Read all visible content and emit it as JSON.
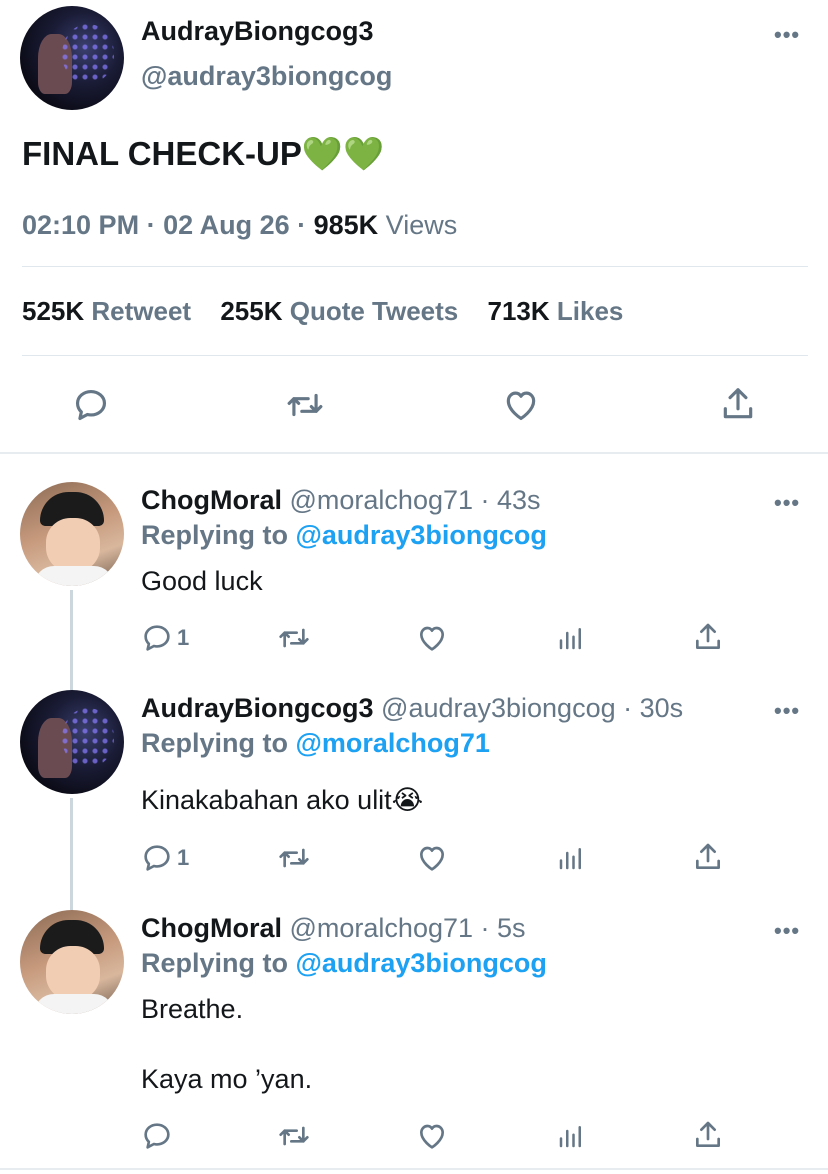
{
  "main_tweet": {
    "author_name": "AudrayBiongcog3",
    "author_handle": "@audray3biongcog",
    "more_icon": "more-icon",
    "text": "FINAL CHECK-UP💚💚",
    "time": "02:10 PM",
    "sep1": " · ",
    "date": "02 Aug 26",
    "sep2": " · ",
    "views_count": "985K",
    "views_label": " Views",
    "retweet_count": "525K",
    "retweet_label": "Retweet",
    "quote_count": "255K",
    "quote_label": "Quote Tweets",
    "likes_count": "713K",
    "likes_label": "Likes",
    "actions": [
      "reply-icon",
      "retweet-icon",
      "like-icon",
      "share-icon"
    ]
  },
  "replies": [
    {
      "name": "ChogMoral",
      "handle": " @moralchog71 · 43s",
      "replying_prefix": "Replying to ",
      "replying_to": "@audray3biongcog",
      "text_lines": [
        "Good luck"
      ],
      "reply_count": "1"
    },
    {
      "name": "AudrayBiongcog3",
      "handle": " @audray3biongcog · 30s",
      "replying_prefix": "Replying to ",
      "replying_to": "@moralchog71",
      "text_lines": [
        "Kinakabahan ako ulit😭"
      ],
      "reply_count": "1"
    },
    {
      "name": "ChogMoral",
      "handle": " @moralchog71 · 5s",
      "replying_prefix": "Replying to ",
      "replying_to": "@audray3biongcog",
      "text_lines": [
        "Breathe.",
        "Kaya mo ’yan."
      ],
      "reply_count": ""
    }
  ],
  "colors": {
    "accent": "#1da1f2",
    "secondary_text": "#657786",
    "primary_text": "#14171a",
    "divider": "#e1e8ed"
  }
}
